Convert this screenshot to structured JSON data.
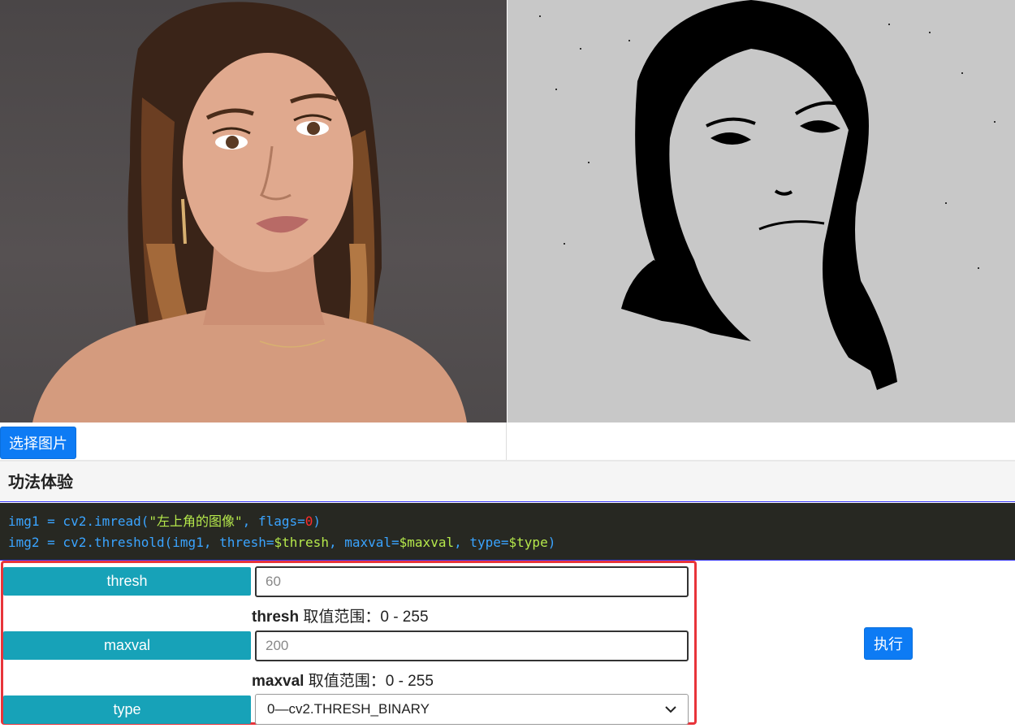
{
  "images": {
    "source_alt": "source portrait",
    "result_alt": "threshold result"
  },
  "select_image_button": "选择图片",
  "section_title": "功法体验",
  "code": {
    "line1": {
      "prefix": "img1 = cv2.imread(",
      "string": "\"左上角的图像\"",
      "mid": ", flags=",
      "number": "0",
      "suffix": ")"
    },
    "line2": {
      "prefix": "img2 = cv2.threshold(img1, thresh=",
      "var1": "$thresh",
      "mid1": ", maxval=",
      "var2": "$maxval",
      "mid2": ", type=",
      "var3": "$type",
      "suffix": ")"
    }
  },
  "params": {
    "thresh": {
      "label": "thresh",
      "placeholder": "60",
      "hint_name": "thresh",
      "hint_text": " 取值范围：0 - 255"
    },
    "maxval": {
      "label": "maxval",
      "placeholder": "200",
      "hint_name": "maxval",
      "hint_text": " 取值范围：0 - 255"
    },
    "type": {
      "label": "type",
      "selected": "0—cv2.THRESH_BINARY"
    }
  },
  "run_button": "执行",
  "colors": {
    "primary_button": "#0d7bf4",
    "param_label": "#17a2b8",
    "highlight_border": "#e8343a",
    "code_bg": "#272822"
  }
}
